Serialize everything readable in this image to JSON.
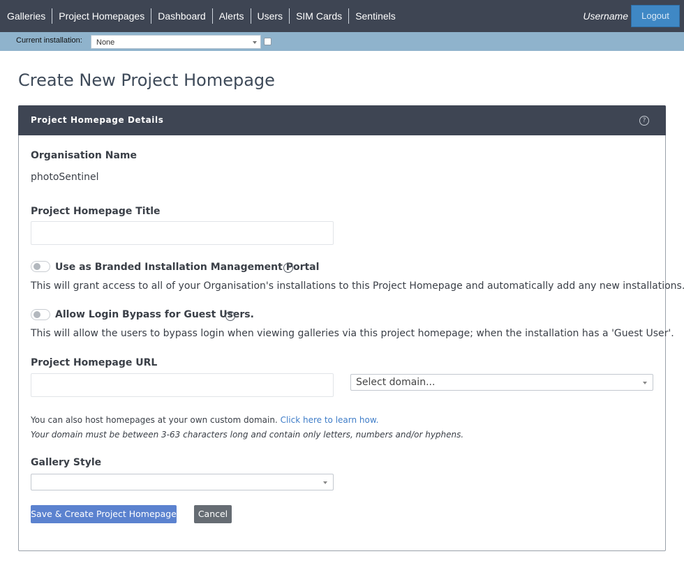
{
  "nav": {
    "links": [
      "Galleries",
      "Project Homepages",
      "Dashboard",
      "Alerts",
      "Users",
      "SIM Cards",
      "Sentinels"
    ],
    "username": "Username",
    "logout_label": "Logout"
  },
  "installation": {
    "label": "Current installation:",
    "selected": "None",
    "checked": false
  },
  "page": {
    "title": "Create New Project Homepage"
  },
  "panel": {
    "title": "Project Homepage Details",
    "help_glyph": "?"
  },
  "form": {
    "org_name_label": "Organisation Name",
    "org_name_value": "photoSentinel",
    "homepage_title_label": "Project Homepage Title",
    "homepage_title_value": "",
    "branded_portal": {
      "label": "Use as Branded Installation Management Portal",
      "enabled": false,
      "description": "This will grant access to all of your Organisation's installations to this Project Homepage and automatically add any new installations."
    },
    "login_bypass": {
      "label": "Allow Login Bypass for Guest Users.",
      "enabled": false,
      "description": "This will allow the users to bypass login when viewing galleries via this project homepage; when the installation has a 'Guest User'."
    },
    "url_label": "Project Homepage URL",
    "url_value": "",
    "domain_select": "Select domain...",
    "custom_domain_text": "You can also host homepages at your own custom domain.",
    "custom_domain_link": "Click here to learn how.",
    "domain_rule": "Your domain must be between 3-63 characters long and contain only letters, numbers and/or hyphens.",
    "gallery_style_label": "Gallery Style",
    "gallery_style_value": ""
  },
  "actions": {
    "save_label": "Save & Create Project Homepage",
    "cancel_label": "Cancel"
  },
  "colors": {
    "nav_bg": "#3e4553",
    "install_bar_bg": "#8fb3cc",
    "primary_button": "#5b82cf",
    "secondary_button": "#666c73",
    "logout_button": "#3f88c5",
    "link": "#3f7dc8"
  }
}
